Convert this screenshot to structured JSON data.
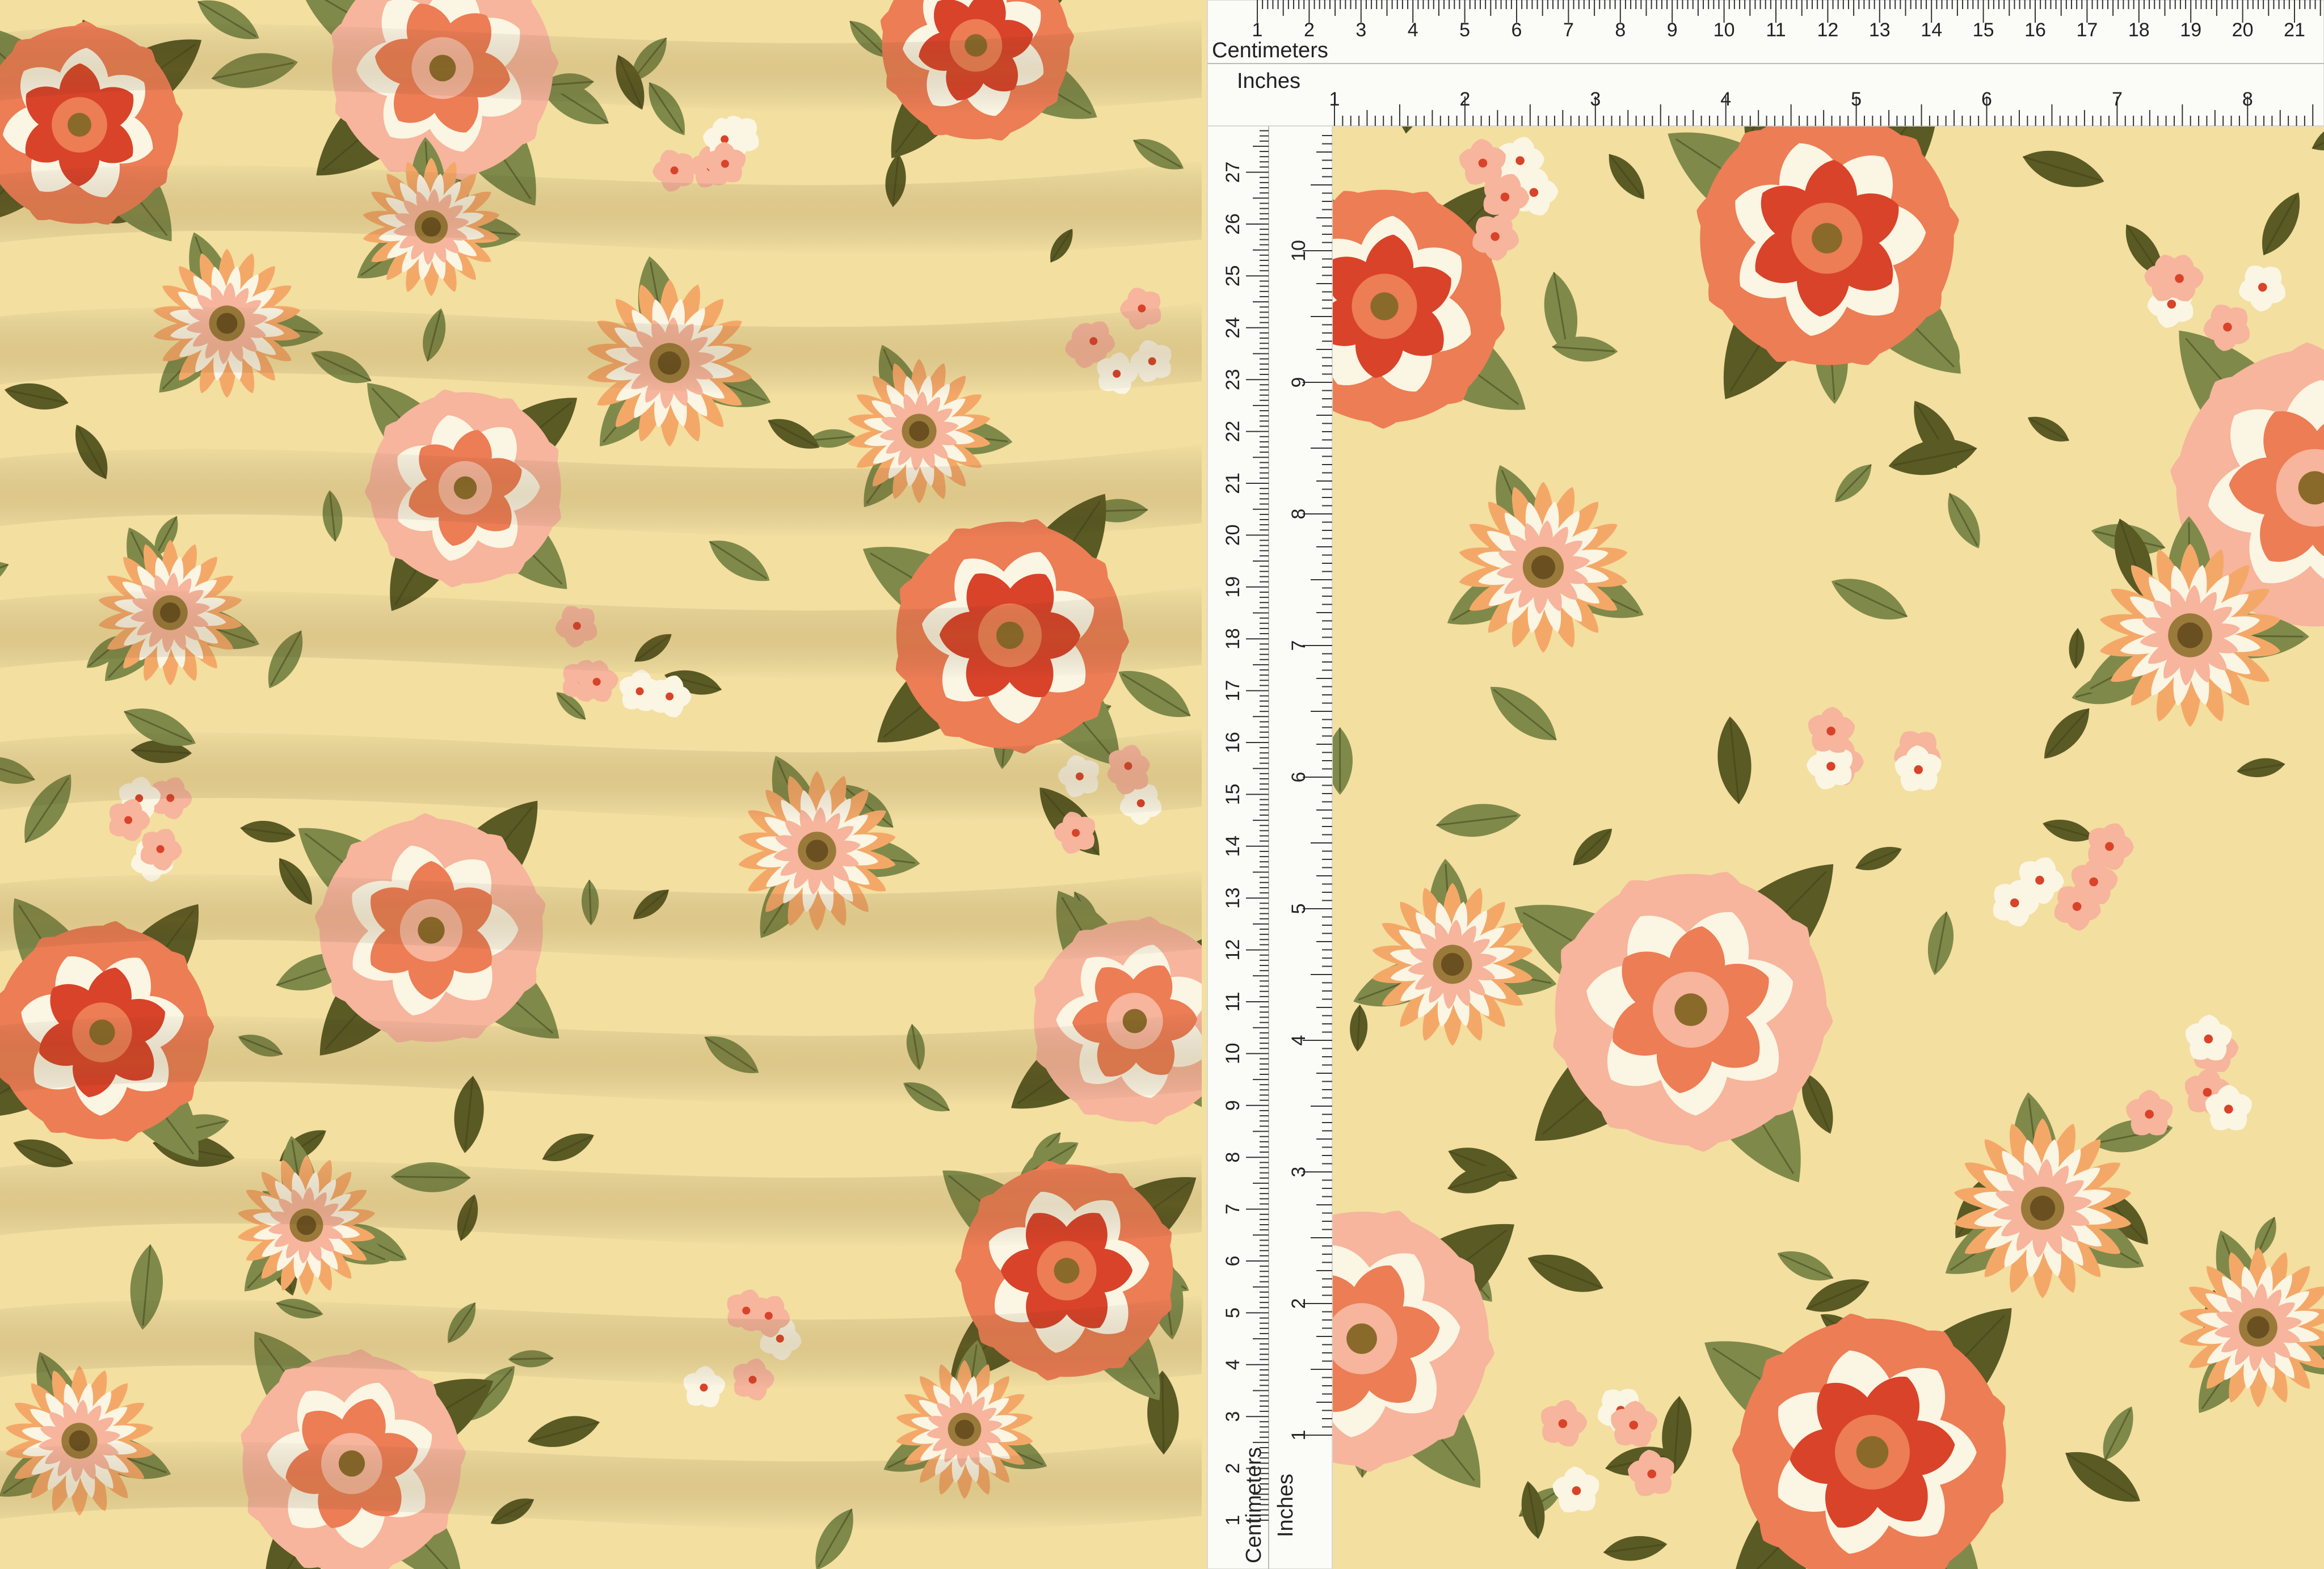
{
  "ruler": {
    "centimeters_label": "Centimeters",
    "inches_label": "Inches",
    "horizontal_cm_ticks": [
      "1",
      "2",
      "3",
      "4",
      "5",
      "6",
      "7",
      "8",
      "9",
      "10",
      "11",
      "12",
      "13",
      "14",
      "15",
      "16",
      "17",
      "18",
      "19",
      "20",
      "21"
    ],
    "horizontal_in_ticks": [
      "1",
      "2",
      "3",
      "4",
      "5",
      "6",
      "7",
      "8"
    ],
    "vertical_cm_ticks": [
      "1",
      "2",
      "3",
      "4",
      "5",
      "6",
      "7",
      "8",
      "9",
      "10",
      "11",
      "12",
      "13",
      "14",
      "15",
      "16",
      "17",
      "18",
      "19",
      "20",
      "21",
      "22",
      "23",
      "24",
      "25",
      "26",
      "27"
    ],
    "vertical_in_ticks": [
      "1",
      "2",
      "3",
      "4",
      "5",
      "6",
      "7",
      "8",
      "9",
      "10"
    ]
  },
  "colors": {
    "fabric_background": "#f3dfa0",
    "ruler": "#fbfbf8",
    "leaf_dark": "#5a5a24",
    "leaf_olive": "#7f8a4a",
    "peony_coral": "#ec7d55",
    "peony_peach": "#f6b59c",
    "rose_red": "#d9432a",
    "daisy_orange": "#f4a868",
    "petal_cream": "#fbf5e3"
  }
}
